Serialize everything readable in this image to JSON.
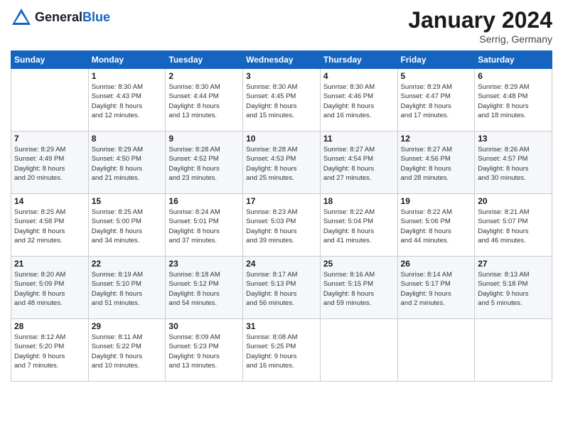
{
  "header": {
    "logo_line1": "General",
    "logo_line2": "Blue",
    "month": "January 2024",
    "location": "Serrig, Germany"
  },
  "weekdays": [
    "Sunday",
    "Monday",
    "Tuesday",
    "Wednesday",
    "Thursday",
    "Friday",
    "Saturday"
  ],
  "weeks": [
    [
      {
        "day": "",
        "info": ""
      },
      {
        "day": "1",
        "info": "Sunrise: 8:30 AM\nSunset: 4:43 PM\nDaylight: 8 hours\nand 12 minutes."
      },
      {
        "day": "2",
        "info": "Sunrise: 8:30 AM\nSunset: 4:44 PM\nDaylight: 8 hours\nand 13 minutes."
      },
      {
        "day": "3",
        "info": "Sunrise: 8:30 AM\nSunset: 4:45 PM\nDaylight: 8 hours\nand 15 minutes."
      },
      {
        "day": "4",
        "info": "Sunrise: 8:30 AM\nSunset: 4:46 PM\nDaylight: 8 hours\nand 16 minutes."
      },
      {
        "day": "5",
        "info": "Sunrise: 8:29 AM\nSunset: 4:47 PM\nDaylight: 8 hours\nand 17 minutes."
      },
      {
        "day": "6",
        "info": "Sunrise: 8:29 AM\nSunset: 4:48 PM\nDaylight: 8 hours\nand 18 minutes."
      }
    ],
    [
      {
        "day": "7",
        "info": "Sunrise: 8:29 AM\nSunset: 4:49 PM\nDaylight: 8 hours\nand 20 minutes."
      },
      {
        "day": "8",
        "info": "Sunrise: 8:29 AM\nSunset: 4:50 PM\nDaylight: 8 hours\nand 21 minutes."
      },
      {
        "day": "9",
        "info": "Sunrise: 8:28 AM\nSunset: 4:52 PM\nDaylight: 8 hours\nand 23 minutes."
      },
      {
        "day": "10",
        "info": "Sunrise: 8:28 AM\nSunset: 4:53 PM\nDaylight: 8 hours\nand 25 minutes."
      },
      {
        "day": "11",
        "info": "Sunrise: 8:27 AM\nSunset: 4:54 PM\nDaylight: 8 hours\nand 27 minutes."
      },
      {
        "day": "12",
        "info": "Sunrise: 8:27 AM\nSunset: 4:56 PM\nDaylight: 8 hours\nand 28 minutes."
      },
      {
        "day": "13",
        "info": "Sunrise: 8:26 AM\nSunset: 4:57 PM\nDaylight: 8 hours\nand 30 minutes."
      }
    ],
    [
      {
        "day": "14",
        "info": "Sunrise: 8:25 AM\nSunset: 4:58 PM\nDaylight: 8 hours\nand 32 minutes."
      },
      {
        "day": "15",
        "info": "Sunrise: 8:25 AM\nSunset: 5:00 PM\nDaylight: 8 hours\nand 34 minutes."
      },
      {
        "day": "16",
        "info": "Sunrise: 8:24 AM\nSunset: 5:01 PM\nDaylight: 8 hours\nand 37 minutes."
      },
      {
        "day": "17",
        "info": "Sunrise: 8:23 AM\nSunset: 5:03 PM\nDaylight: 8 hours\nand 39 minutes."
      },
      {
        "day": "18",
        "info": "Sunrise: 8:22 AM\nSunset: 5:04 PM\nDaylight: 8 hours\nand 41 minutes."
      },
      {
        "day": "19",
        "info": "Sunrise: 8:22 AM\nSunset: 5:06 PM\nDaylight: 8 hours\nand 44 minutes."
      },
      {
        "day": "20",
        "info": "Sunrise: 8:21 AM\nSunset: 5:07 PM\nDaylight: 8 hours\nand 46 minutes."
      }
    ],
    [
      {
        "day": "21",
        "info": "Sunrise: 8:20 AM\nSunset: 5:09 PM\nDaylight: 8 hours\nand 48 minutes."
      },
      {
        "day": "22",
        "info": "Sunrise: 8:19 AM\nSunset: 5:10 PM\nDaylight: 8 hours\nand 51 minutes."
      },
      {
        "day": "23",
        "info": "Sunrise: 8:18 AM\nSunset: 5:12 PM\nDaylight: 8 hours\nand 54 minutes."
      },
      {
        "day": "24",
        "info": "Sunrise: 8:17 AM\nSunset: 5:13 PM\nDaylight: 8 hours\nand 56 minutes."
      },
      {
        "day": "25",
        "info": "Sunrise: 8:16 AM\nSunset: 5:15 PM\nDaylight: 8 hours\nand 59 minutes."
      },
      {
        "day": "26",
        "info": "Sunrise: 8:14 AM\nSunset: 5:17 PM\nDaylight: 9 hours\nand 2 minutes."
      },
      {
        "day": "27",
        "info": "Sunrise: 8:13 AM\nSunset: 5:18 PM\nDaylight: 9 hours\nand 5 minutes."
      }
    ],
    [
      {
        "day": "28",
        "info": "Sunrise: 8:12 AM\nSunset: 5:20 PM\nDaylight: 9 hours\nand 7 minutes."
      },
      {
        "day": "29",
        "info": "Sunrise: 8:11 AM\nSunset: 5:22 PM\nDaylight: 9 hours\nand 10 minutes."
      },
      {
        "day": "30",
        "info": "Sunrise: 8:09 AM\nSunset: 5:23 PM\nDaylight: 9 hours\nand 13 minutes."
      },
      {
        "day": "31",
        "info": "Sunrise: 8:08 AM\nSunset: 5:25 PM\nDaylight: 9 hours\nand 16 minutes."
      },
      {
        "day": "",
        "info": ""
      },
      {
        "day": "",
        "info": ""
      },
      {
        "day": "",
        "info": ""
      }
    ]
  ]
}
